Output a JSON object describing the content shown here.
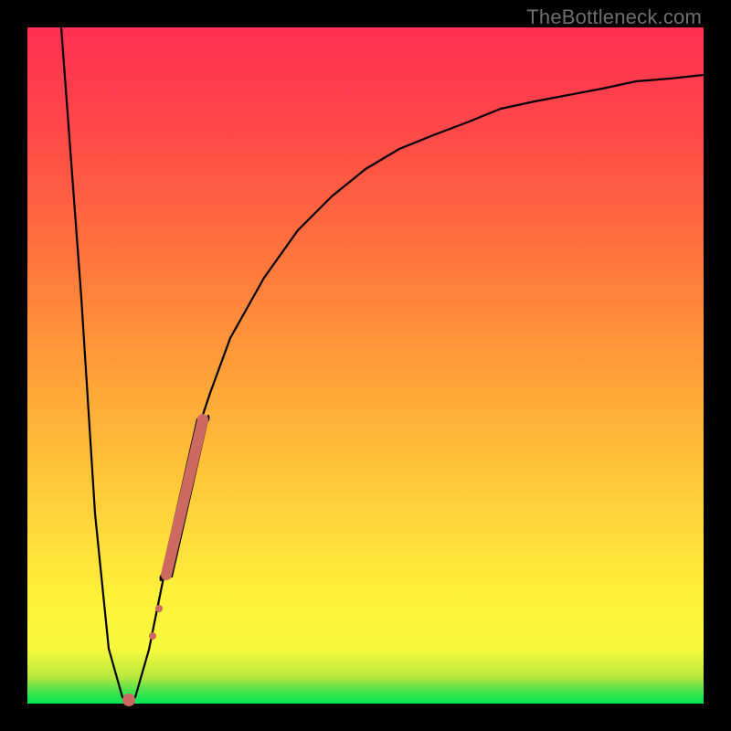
{
  "watermark": "TheBottleneck.com",
  "colors": {
    "frame": "#000000",
    "curve": "#000000",
    "marker": "#cc6a62"
  },
  "chart_data": {
    "type": "line",
    "title": "",
    "xlabel": "",
    "ylabel": "",
    "xlim": [
      0,
      100
    ],
    "ylim": [
      0,
      100
    ],
    "grid": false,
    "series": [
      {
        "name": "bottleneck-curve",
        "x": [
          5,
          8,
          10,
          12,
          14,
          15,
          16,
          18,
          20,
          22,
          24,
          27,
          30,
          35,
          40,
          45,
          50,
          55,
          60,
          65,
          70,
          75,
          80,
          85,
          90,
          95,
          100
        ],
        "y": [
          100,
          60,
          28,
          8,
          1,
          0,
          1,
          8,
          18,
          28,
          37,
          46,
          54,
          63,
          70,
          75,
          79,
          82,
          84,
          86,
          88,
          89,
          90,
          91,
          92,
          92.5,
          93
        ]
      }
    ],
    "markers": [
      {
        "kind": "dot",
        "x": 15.0,
        "y": 0.5,
        "r": 7
      },
      {
        "kind": "dot",
        "x": 18.5,
        "y": 10.0,
        "r": 4
      },
      {
        "kind": "dot",
        "x": 19.5,
        "y": 14.0,
        "r": 4
      },
      {
        "kind": "capsule",
        "x1": 20.5,
        "y1": 19.0,
        "x2": 26.0,
        "y2": 42.0,
        "r": 6
      }
    ],
    "background_gradient_stops": [
      {
        "pos": 0.0,
        "color": "#00e756"
      },
      {
        "pos": 0.08,
        "color": "#f6f93e"
      },
      {
        "pos": 0.5,
        "color": "#ffa338"
      },
      {
        "pos": 1.0,
        "color": "#ff2f53"
      }
    ]
  }
}
